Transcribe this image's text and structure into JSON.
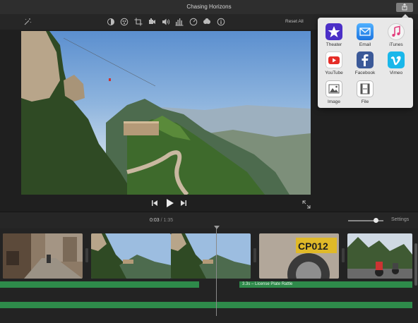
{
  "window": {
    "title": "Chasing Horizons"
  },
  "toolbar": {
    "icons": [
      "magic-wand-icon",
      "color-balance-icon",
      "color-correction-icon",
      "crop-icon",
      "stabilization-icon",
      "volume-icon",
      "equalizer-icon",
      "speed-icon",
      "noise-reduction-icon",
      "info-icon"
    ],
    "reset_label": "Reset All"
  },
  "share_menu": {
    "items": [
      {
        "label": "Theater",
        "icon": "theater-icon",
        "color": "#4b2fc7"
      },
      {
        "label": "Email",
        "icon": "email-icon",
        "color": "#2a8cf0"
      },
      {
        "label": "iTunes",
        "icon": "itunes-icon",
        "color": "#f2f2f2"
      },
      {
        "label": "YouTube",
        "icon": "youtube-icon",
        "color": "#ffffff"
      },
      {
        "label": "Facebook",
        "icon": "facebook-icon",
        "color": "#3b5998"
      },
      {
        "label": "Vimeo",
        "icon": "vimeo-icon",
        "color": "#1ab7ea"
      },
      {
        "label": "Image",
        "icon": "image-icon",
        "color": "#ffffff"
      },
      {
        "label": "File",
        "icon": "file-icon",
        "color": "#ffffff"
      }
    ]
  },
  "playback": {
    "current": "0:03",
    "separator": "/",
    "total": "1:35"
  },
  "timeline": {
    "settings_label": "Settings",
    "zoom_level": 0.72,
    "audio_clip_label": "3.3s – License Plate Rattle"
  }
}
